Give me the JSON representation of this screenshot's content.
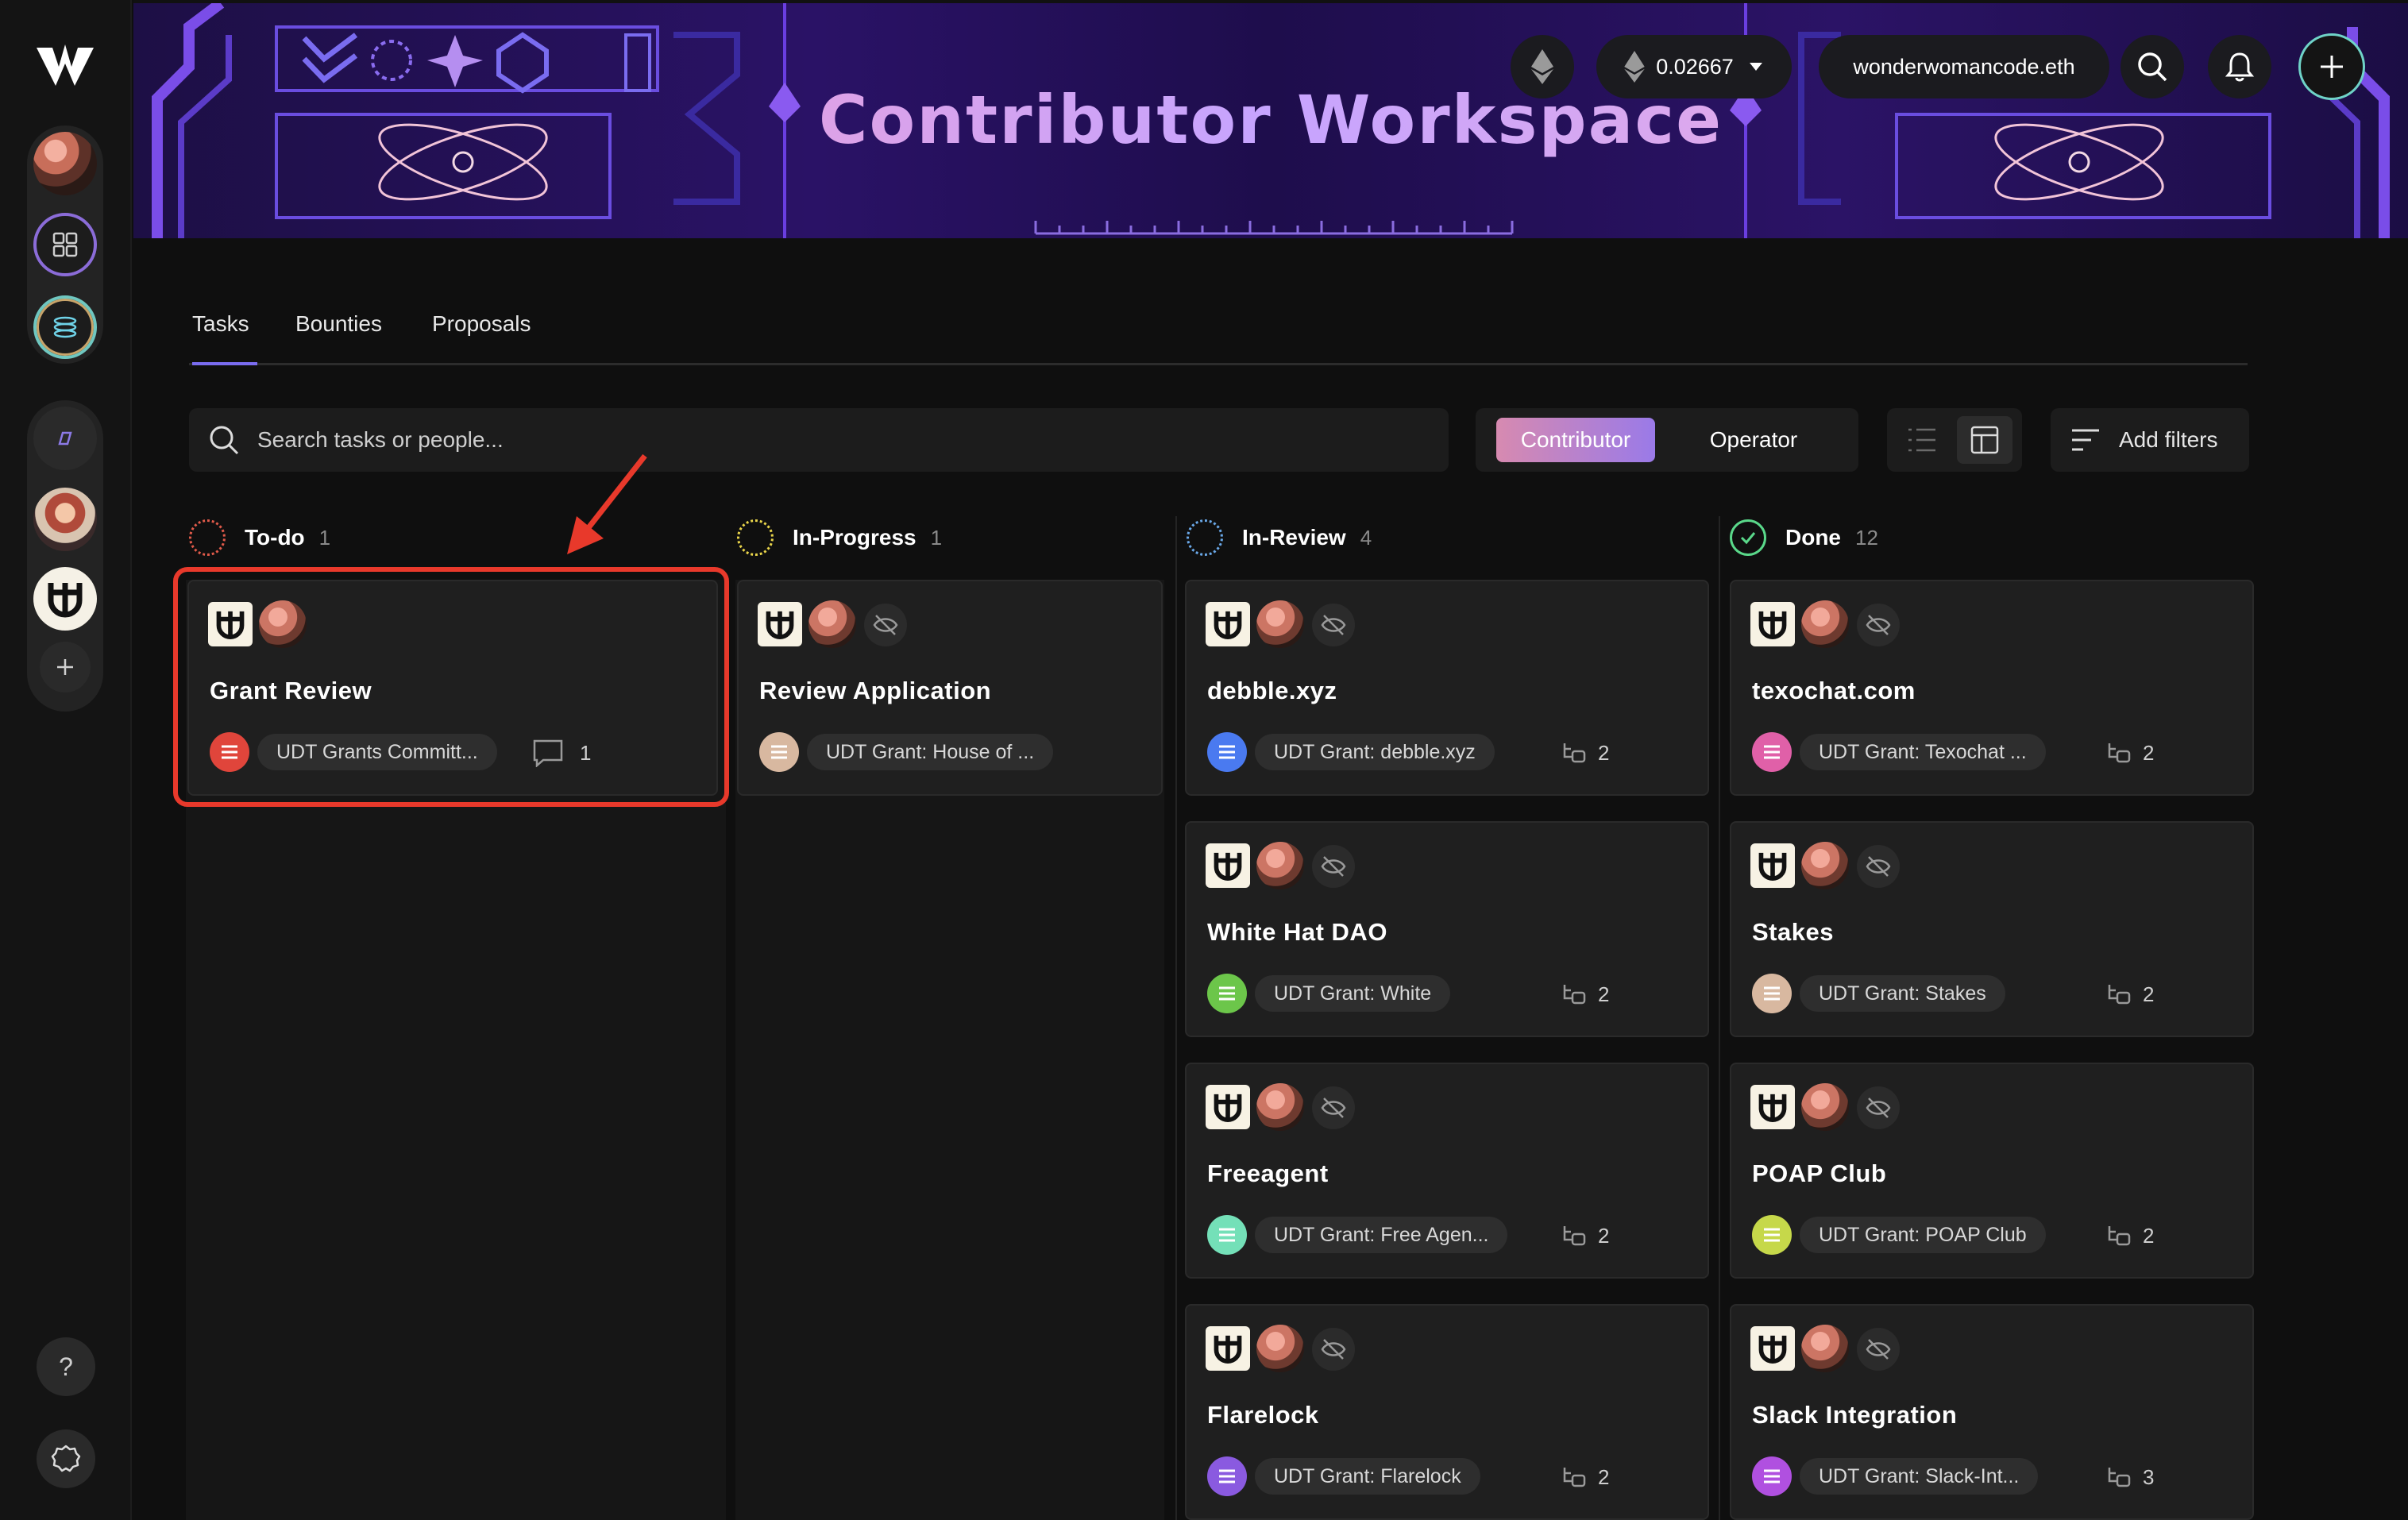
{
  "header": {
    "title": "Contributor Workspace",
    "balance": "0.02667",
    "account": "wonderwomancode.eth"
  },
  "tabs": [
    {
      "label": "Tasks",
      "active": true
    },
    {
      "label": "Bounties",
      "active": false
    },
    {
      "label": "Proposals",
      "active": false
    }
  ],
  "search": {
    "placeholder": "Search tasks or people..."
  },
  "roles": {
    "contributor": "Contributor",
    "operator": "Operator",
    "selected": "Contributor"
  },
  "filters_label": "Add filters",
  "colors": {
    "accent": "#7a6cf0",
    "highlight": "#e8392b",
    "contributor_btn": "#c28ad8"
  },
  "columns": [
    {
      "title": "To-do",
      "count": "1",
      "icon": "todo-icon"
    },
    {
      "title": "In-Progress",
      "count": "1",
      "icon": "in-progress-icon"
    },
    {
      "title": "In-Review",
      "count": "4",
      "icon": "in-review-icon"
    },
    {
      "title": "Done",
      "count": "12",
      "icon": "done-icon"
    }
  ],
  "cards": {
    "todo": [
      {
        "title": "Grant Review",
        "grant": "UDT Grants Committ...",
        "grant_color": "#e0453b",
        "meta_icon": "comment-icon",
        "meta_count": "1",
        "private": false
      }
    ],
    "in_progress": [
      {
        "title": "Review Application",
        "grant": "UDT Grant: House of ...",
        "grant_color": "#d8b8a0",
        "private": true
      }
    ],
    "in_review": [
      {
        "title": "debble.xyz",
        "grant": "UDT Grant: debble.xyz",
        "grant_color": "#4a7af0",
        "meta_icon": "subtask-icon",
        "meta_count": "2",
        "private": true
      },
      {
        "title": "White Hat DAO",
        "grant": "UDT Grant: White",
        "grant_color": "#6cc64a",
        "meta_icon": "subtask-icon",
        "meta_count": "2",
        "private": true
      },
      {
        "title": "Freeagent",
        "grant": "UDT Grant: Free Agen...",
        "grant_color": "#74e0b8",
        "meta_icon": "subtask-icon",
        "meta_count": "2",
        "private": true
      },
      {
        "title": "Flarelock",
        "grant": "UDT Grant: Flarelock",
        "grant_color": "#8a5ae0",
        "meta_icon": "subtask-icon",
        "meta_count": "2",
        "private": true
      }
    ],
    "done": [
      {
        "title": "texochat.com",
        "grant": "UDT Grant: Texochat ...",
        "grant_color": "#e060a8",
        "meta_icon": "subtask-icon",
        "meta_count": "2",
        "private": true
      },
      {
        "title": "Stakes",
        "grant": "UDT Grant: Stakes",
        "grant_color": "#d8b8a0",
        "meta_icon": "subtask-icon",
        "meta_count": "2",
        "private": true
      },
      {
        "title": "POAP Club",
        "grant": "UDT Grant: POAP Club",
        "grant_color": "#c6d84a",
        "meta_icon": "subtask-icon",
        "meta_count": "2",
        "private": true
      },
      {
        "title": "Slack Integration",
        "grant": "UDT Grant: Slack-Int...",
        "grant_color": "#b050e0",
        "meta_icon": "subtask-icon",
        "meta_count": "3",
        "private": true
      }
    ]
  }
}
